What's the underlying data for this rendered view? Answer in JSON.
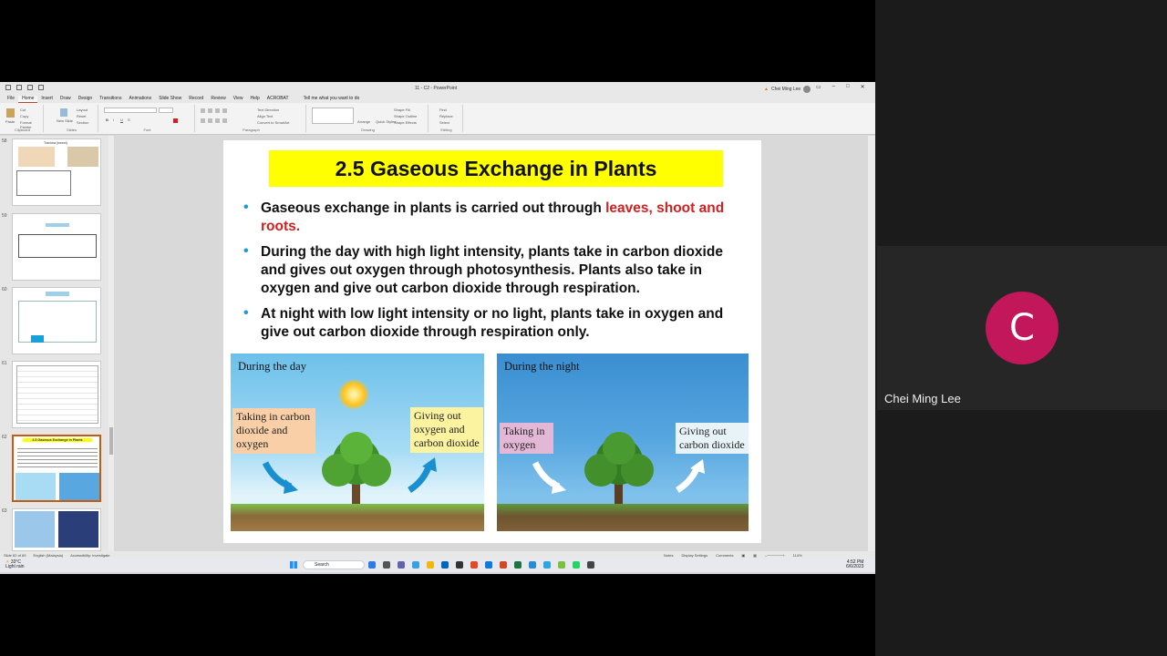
{
  "window": {
    "title": "11 - C2  -  PowerPoint",
    "user_name": "Chei Ming Lee",
    "user_initials": "CL"
  },
  "menu": {
    "tabs": [
      "File",
      "Home",
      "Insert",
      "Draw",
      "Design",
      "Transitions",
      "Animations",
      "Slide Show",
      "Record",
      "Review",
      "View",
      "Help",
      "ACROBAT"
    ],
    "active_tab": "Home",
    "tell_me": "Tell me what you want to do"
  },
  "ribbon": {
    "groups": [
      "Clipboard",
      "Slides",
      "Font",
      "Paragraph",
      "Drawing",
      "Editing"
    ],
    "clipboard_items": [
      "Paste",
      "Cut",
      "Copy",
      "Format Painter"
    ],
    "slides_items": [
      "New Slide",
      "Layout",
      "Reset",
      "Section"
    ],
    "paragraph_items": [
      "Text Direction",
      "Align Text",
      "Convert to SmartArt"
    ],
    "drawing_items": [
      "Arrange",
      "Quick Styles",
      "Shape Fill",
      "Shape Outline",
      "Shape Effects"
    ],
    "editing_items": [
      "Find",
      "Replace",
      "Select"
    ]
  },
  "thumbnails": [
    {
      "num": "58",
      "title": "Trachea (insect)"
    },
    {
      "num": "59",
      "title": ""
    },
    {
      "num": "60",
      "title": ""
    },
    {
      "num": "61",
      "title": ""
    },
    {
      "num": "62",
      "title": "2.5 Gaseous Exchange in Plants"
    },
    {
      "num": "63",
      "title": ""
    }
  ],
  "slide": {
    "title": "2.5 Gaseous Exchange in Plants",
    "bullets": [
      {
        "text": "Gaseous exchange in plants is carried out through ",
        "highlight": "leaves, shoot and roots."
      },
      {
        "text": "During the day with high light intensity, plants take in carbon dioxide and gives out oxygen through photosynthesis. Plants also take in oxygen and give out carbon dioxide through respiration.",
        "highlight": ""
      },
      {
        "text": "At night with low light intensity or no light, plants take in oxygen and give out carbon dioxide through respiration only.",
        "highlight": ""
      }
    ],
    "day_panel": {
      "title": "During the day",
      "in_label": "Taking in carbon dioxide and oxygen",
      "out_label": "Giving  out oxygen  and carbon dioxide"
    },
    "night_panel": {
      "title": "During the night",
      "in_label": "Taking in oxygen",
      "out_label": "Giving out carbon dioxide"
    }
  },
  "statusbar": {
    "slide_info": "Slide 62 of 69",
    "language": "English (Malaysia)",
    "accessibility": "Accessibility: Investigate",
    "notes": "Notes",
    "display_settings": "Display Settings",
    "comments": "Comments",
    "zoom": "114%"
  },
  "taskbar": {
    "temperature": "33°C",
    "weather": "Light rain",
    "search": "Search",
    "time": "4:52 PM",
    "date": "6/6/2023"
  },
  "meeting": {
    "participant_initial": "C",
    "participant_name": "Chei Ming Lee",
    "avatar_color": "#c2185b"
  }
}
